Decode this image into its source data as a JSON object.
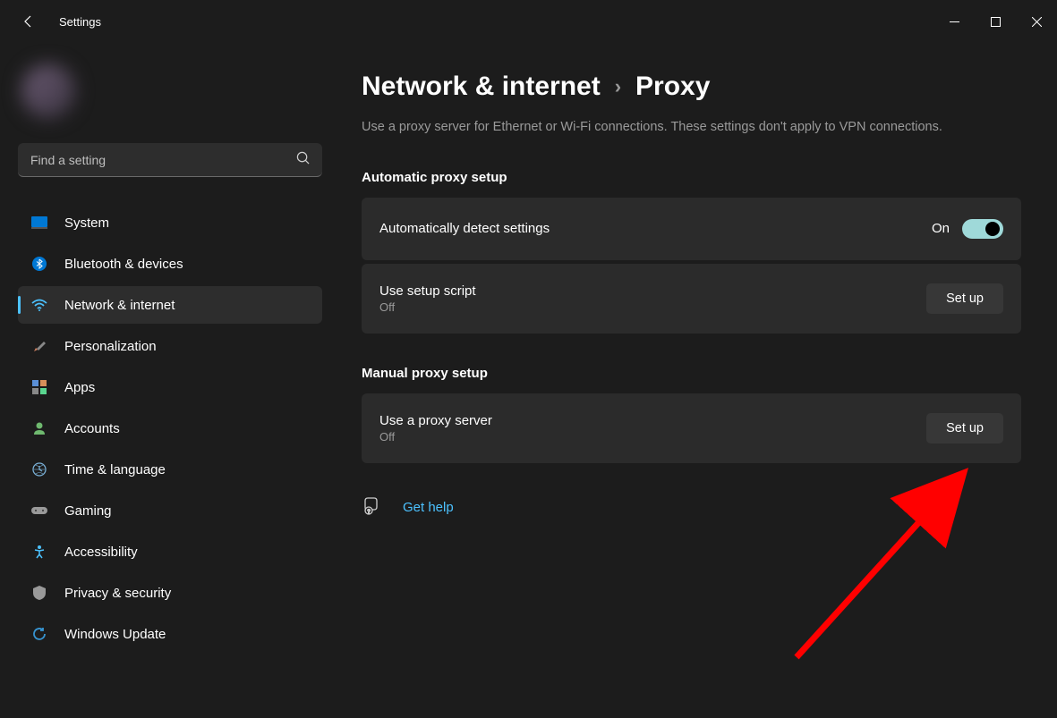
{
  "window": {
    "title": "Settings"
  },
  "profile": {
    "name": "",
    "email": ""
  },
  "search": {
    "placeholder": "Find a setting"
  },
  "nav": {
    "items": [
      {
        "icon": "display-icon",
        "label": "System"
      },
      {
        "icon": "bluetooth-icon",
        "label": "Bluetooth & devices"
      },
      {
        "icon": "wifi-icon",
        "label": "Network & internet",
        "active": true
      },
      {
        "icon": "brush-icon",
        "label": "Personalization"
      },
      {
        "icon": "apps-icon",
        "label": "Apps"
      },
      {
        "icon": "accounts-icon",
        "label": "Accounts"
      },
      {
        "icon": "time-icon",
        "label": "Time & language"
      },
      {
        "icon": "gaming-icon",
        "label": "Gaming"
      },
      {
        "icon": "accessibility-icon",
        "label": "Accessibility"
      },
      {
        "icon": "privacy-icon",
        "label": "Privacy & security"
      },
      {
        "icon": "update-icon",
        "label": "Windows Update"
      }
    ]
  },
  "breadcrumb": {
    "parent": "Network & internet",
    "current": "Proxy"
  },
  "description": "Use a proxy server for Ethernet or Wi-Fi connections. These settings don't apply to VPN connections.",
  "sections": {
    "auto": {
      "title": "Automatic proxy setup",
      "row1": {
        "title": "Automatically detect settings",
        "toggle_label": "On",
        "state": true
      },
      "row2": {
        "title": "Use setup script",
        "sub": "Off",
        "button": "Set up"
      }
    },
    "manual": {
      "title": "Manual proxy setup",
      "row1": {
        "title": "Use a proxy server",
        "sub": "Off",
        "button": "Set up"
      }
    }
  },
  "help": {
    "label": "Get help"
  },
  "colors": {
    "accent": "#4cc2ff",
    "toggle_on": "#9fd9d9"
  }
}
